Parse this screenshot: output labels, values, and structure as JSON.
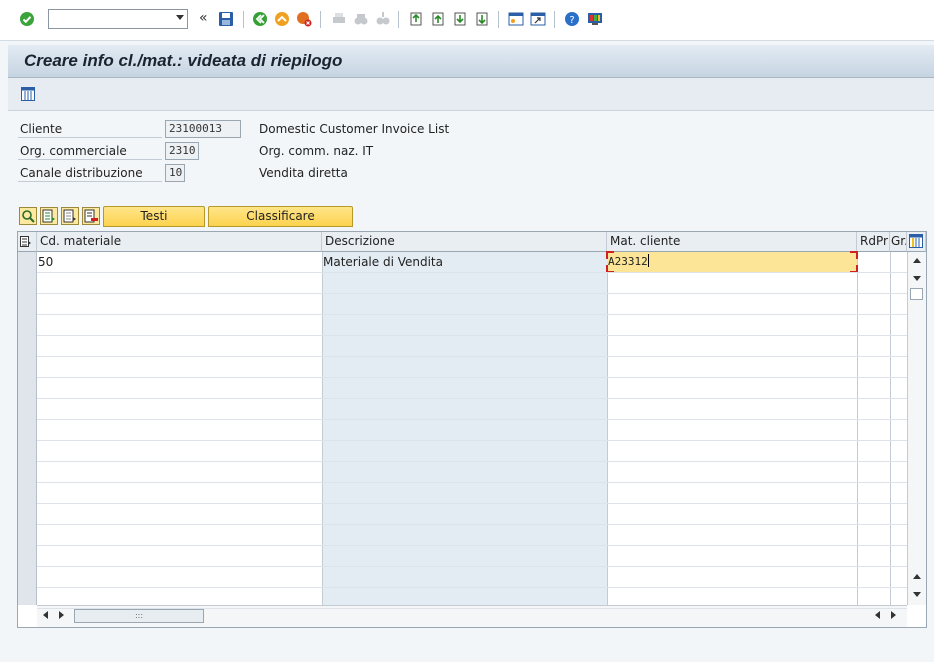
{
  "toolbar": {
    "command_field_value": "",
    "icons": [
      "enter-icon",
      "back-icon",
      "save-icon",
      "back-green-icon",
      "exit-icon",
      "cancel-icon",
      "print-icon",
      "find-icon",
      "find-next-icon",
      "first-page-icon",
      "prev-page-icon",
      "next-page-icon",
      "last-page-icon",
      "new-session-icon",
      "shortcut-icon",
      "help-icon",
      "customize-layout-icon"
    ]
  },
  "title": "Creare info cl./mat.: videata di riepilogo",
  "header": {
    "fields": [
      {
        "label": "Cliente",
        "value": "23100013",
        "description": "Domestic Customer Invoice List"
      },
      {
        "label": "Org. commerciale",
        "value": "2310",
        "description": "Org. comm. naz. IT"
      },
      {
        "label": "Canale distribuzione",
        "value": "10",
        "description": "Vendita diretta"
      }
    ]
  },
  "grid_toolbar": {
    "buttons": [
      "Testi",
      "Classificare"
    ],
    "icons": [
      "detail-icon",
      "select-all-icon",
      "deselect-all-icon",
      "delete-row-icon"
    ]
  },
  "table": {
    "columns": [
      "Cd. materiale",
      "Descrizione",
      "Mat. cliente",
      "RdPr",
      "Gr."
    ],
    "rows": [
      {
        "cd_materiale": "50",
        "descrizione": "Materiale di Vendita",
        "mat_cliente": "A23312",
        "rdpr": "",
        "gr": ""
      }
    ]
  },
  "colors": {
    "accent_yellow": "#fcd34e",
    "title_bar": "#c6d4e2",
    "desc_column": "#e4ecf3",
    "selected_cell": "#fde597"
  }
}
